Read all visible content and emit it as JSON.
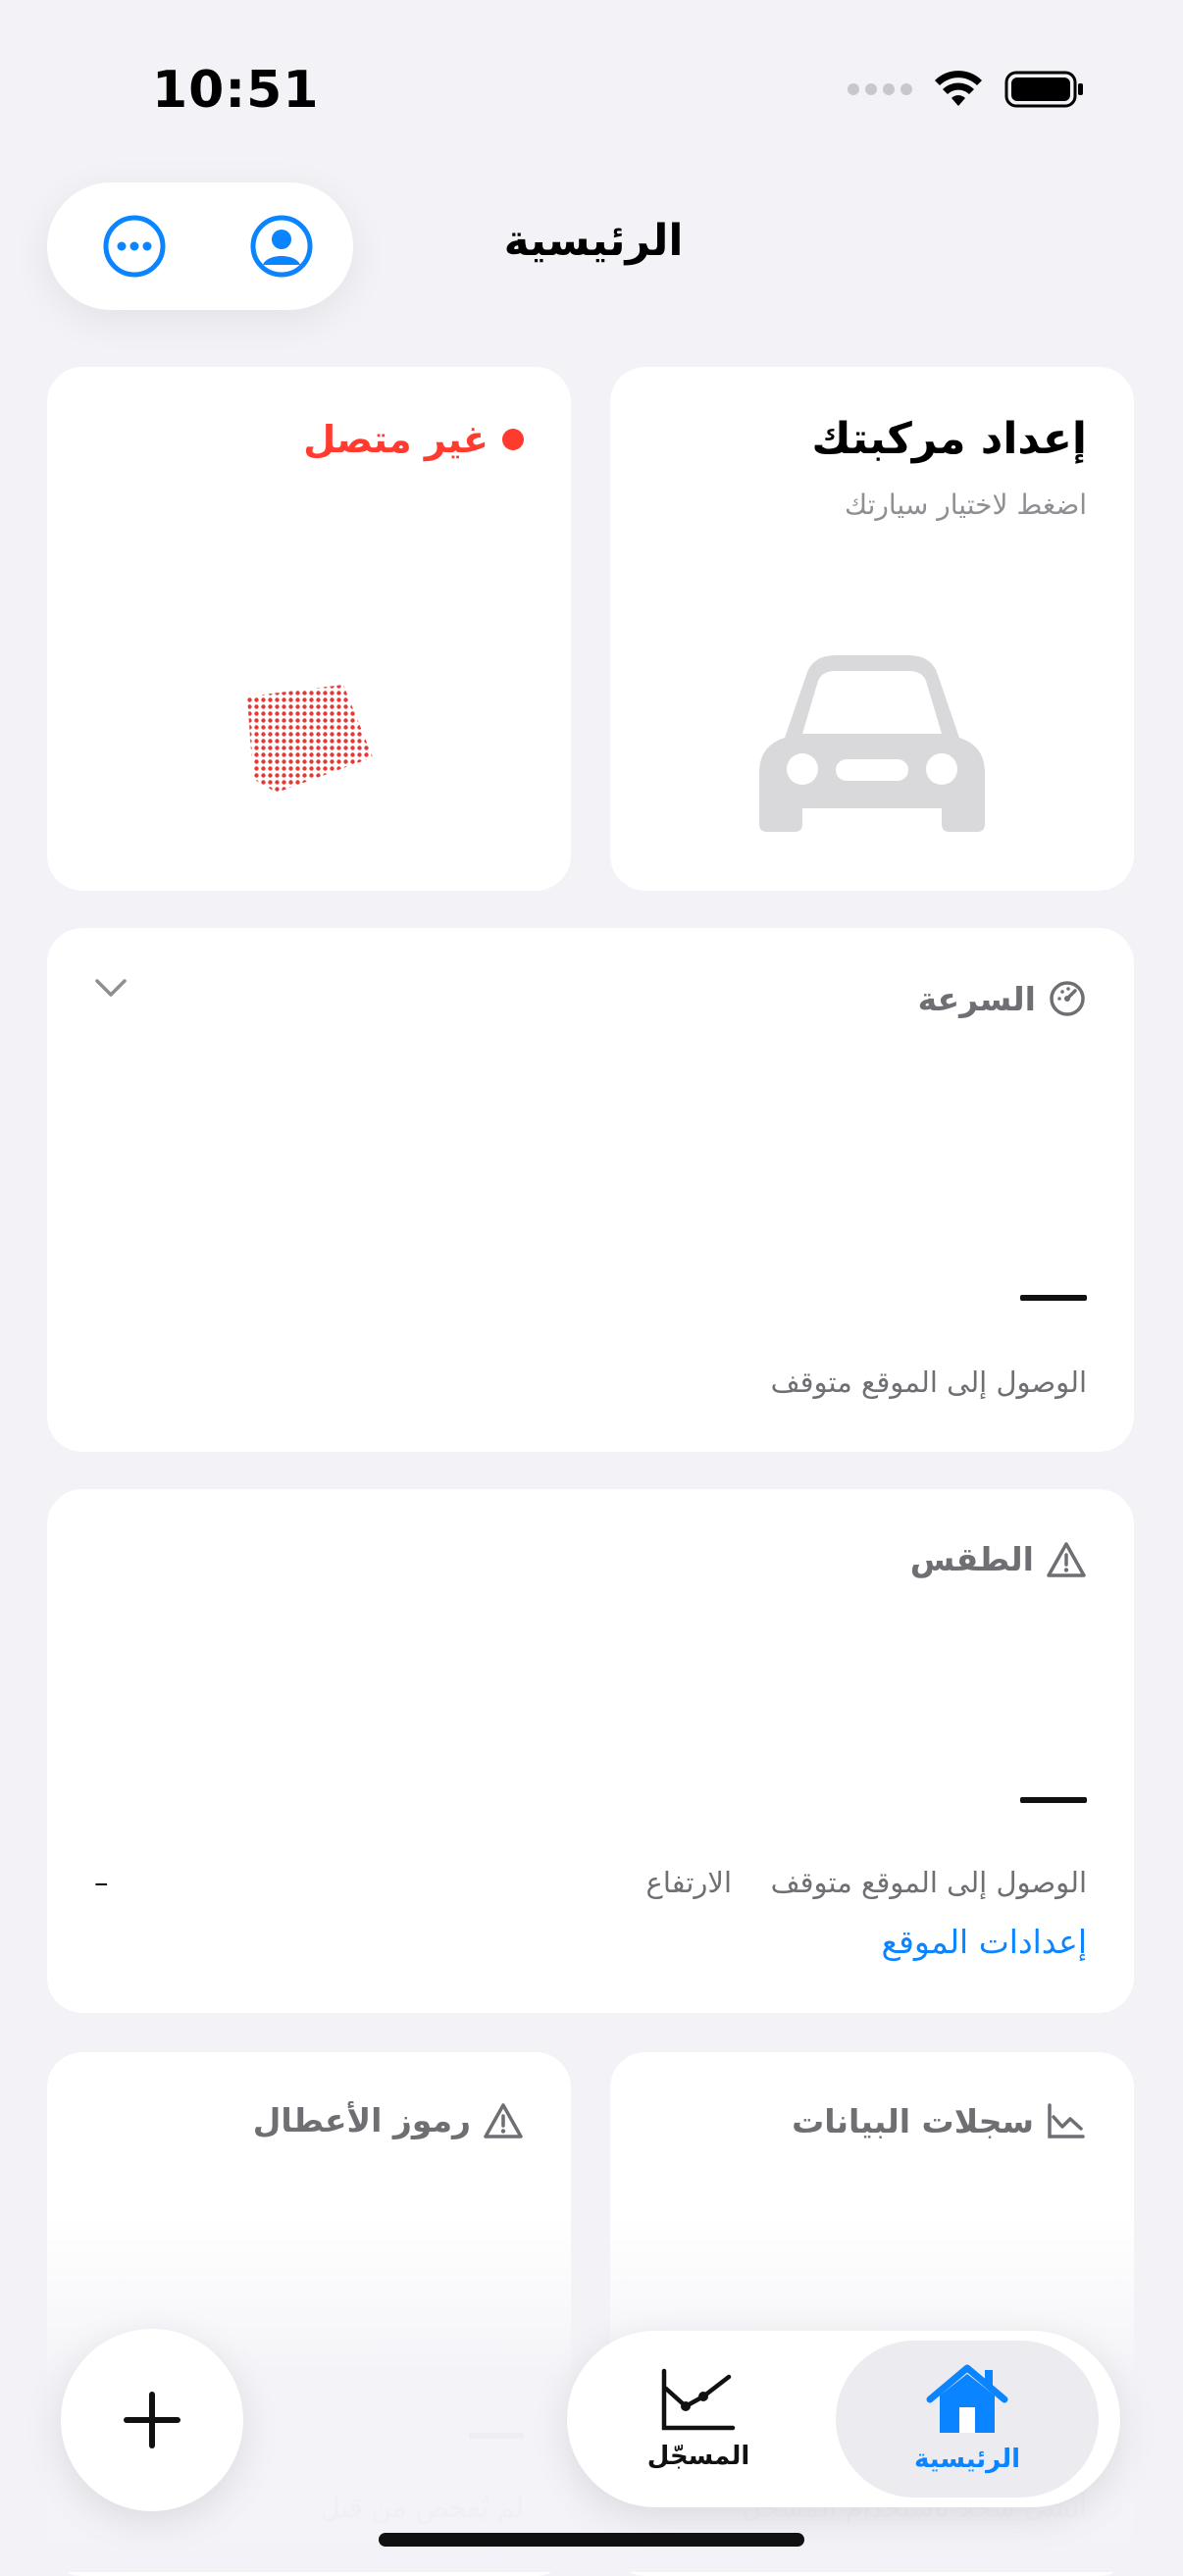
{
  "status_bar": {
    "time": "10:51"
  },
  "header": {
    "title": "الرئيسية",
    "profile_icon": "person-circle-icon",
    "more_icon": "ellipsis-circle-icon"
  },
  "vehicle_card": {
    "title": "إعداد مركبتك",
    "subtitle": "اضغط لاختيار سيارتك",
    "icon": "car-icon"
  },
  "connection_card": {
    "status": "غير متصل",
    "status_color": "#ff3b30"
  },
  "speed_card": {
    "title": "السرعة",
    "icon": "speedometer-icon",
    "value": "—",
    "note": "الوصول إلى الموقع متوقف"
  },
  "weather_card": {
    "title": "الطقس",
    "icon": "warning-triangle-icon",
    "value": "—",
    "note": "الوصول إلى الموقع متوقف",
    "altitude_label": "الارتفاع",
    "altitude_value": "–",
    "settings_link": "إعدادات الموقع"
  },
  "logs_card": {
    "title": "سجلات البيانات",
    "icon": "chart-icon",
    "faded_note": "أنشئ سجلاً باستخدام المسجل"
  },
  "dtc_card": {
    "title": "رموز الأعطال",
    "icon": "warning-triangle-icon",
    "faded_note": "لم يُفحص من قبل"
  },
  "tab_bar": {
    "tabs": [
      {
        "label": "الرئيسية",
        "icon": "house-icon",
        "active": true
      },
      {
        "label": "المسجّل",
        "icon": "logger-chart-icon",
        "active": false
      }
    ],
    "add_icon": "plus-icon"
  },
  "colors": {
    "accent": "#0a84ff",
    "error": "#ff3b30",
    "background": "#f2f2f7"
  }
}
